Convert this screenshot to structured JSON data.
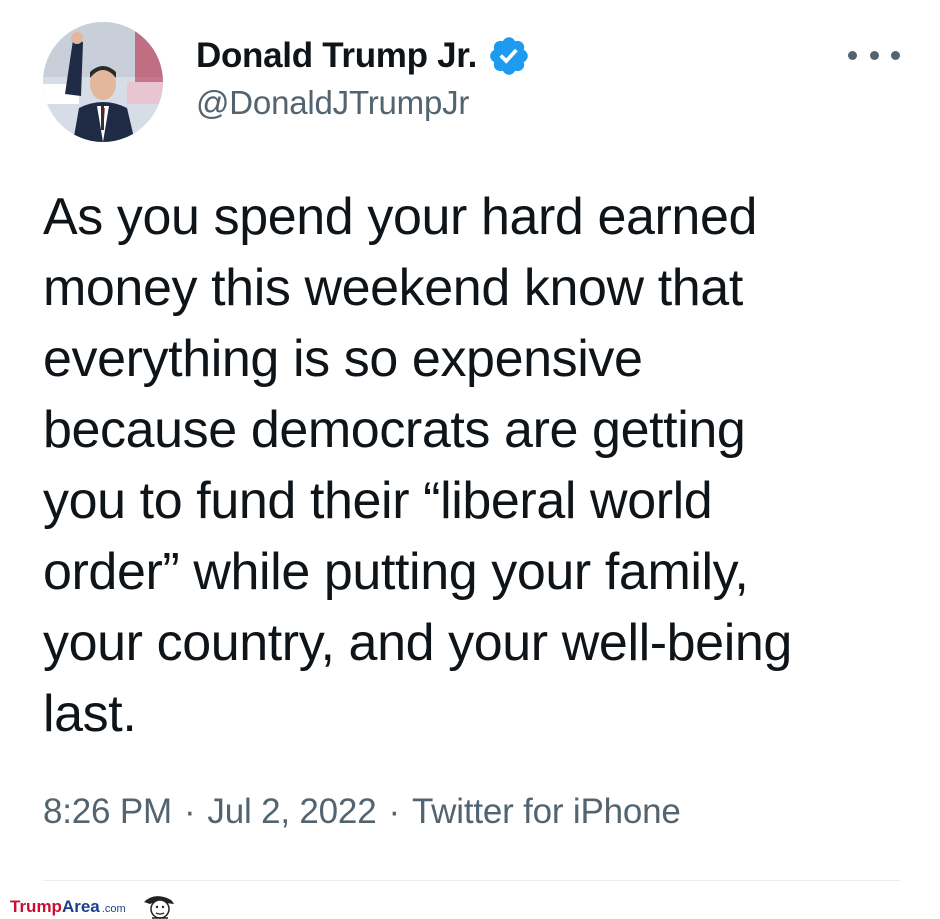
{
  "author": {
    "display_name": "Donald Trump Jr.",
    "handle": "@DonaldJTrumpJr",
    "verified": true,
    "avatar_icon": "profile-photo"
  },
  "tweet": {
    "lines": [
      "As you spend your hard earned",
      "money this weekend know that",
      "everything is so expensive",
      "because democrats are getting",
      "you to fund their “liberal world",
      "order” while putting your family,",
      "your country, and your well-being",
      "last."
    ],
    "time": "8:26 PM",
    "separator": "·",
    "date": "Jul 2, 2022",
    "source": "Twitter for iPhone"
  },
  "more_icon": "more-dots-icon",
  "watermark": {
    "part1": "Trump",
    "part2": "Area",
    "part3": ".com"
  },
  "colors": {
    "verified_blue": "#1d9bf0",
    "secondary_text": "#536471",
    "primary_text": "#0f1419",
    "watermark_red": "#c8102e",
    "watermark_blue": "#1b3f8f"
  }
}
